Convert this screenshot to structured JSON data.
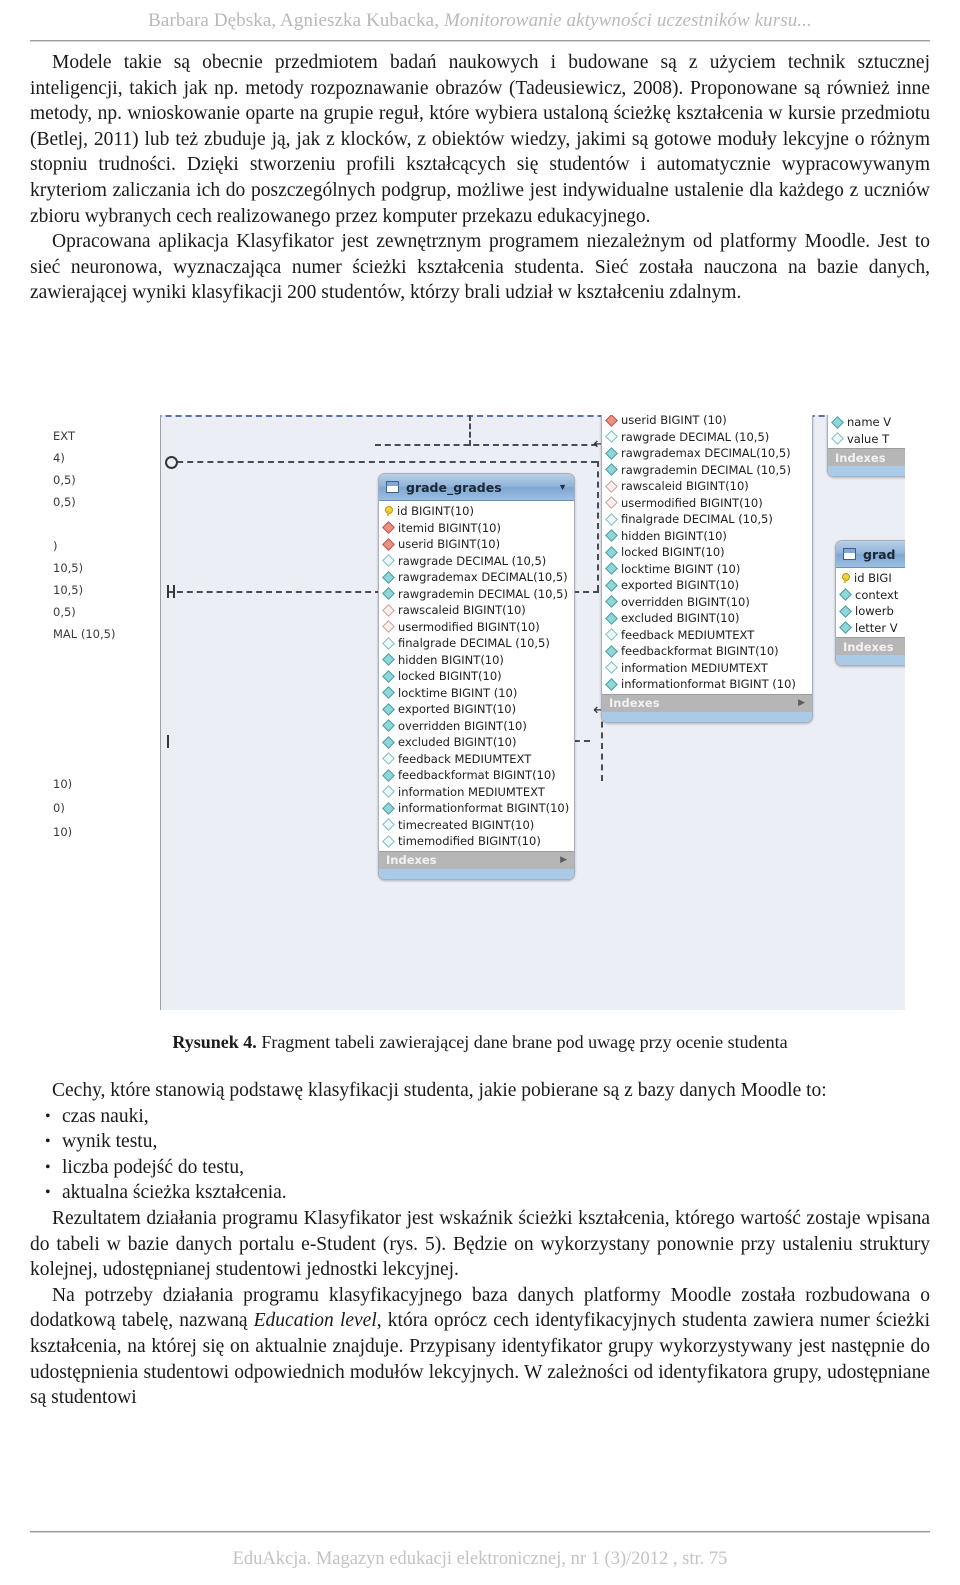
{
  "running_head": {
    "authors": "Barbara Dębska, Agnieszka Kubacka,",
    "title_italic": "Monitorowanie aktywności uczestników kursu..."
  },
  "body": {
    "paragraph_1": "Modele takie są obecnie przedmiotem badań naukowych i budowane są z użyciem technik sztucznej inteligencji, takich jak np. metody rozpoznawanie obrazów (Tadeusiewicz, 2008). Proponowane są również inne metody, np. wnioskowanie oparte na grupie reguł, które wybiera ustaloną ścieżkę kształcenia w kursie przedmiotu (Betlej, 2011) lub też zbuduje ją, jak z klocków, z obiektów wiedzy, jakimi są gotowe moduły lekcyjne o różnym stopniu trudności. Dzięki stworzeniu profili kształcących się studentów i automatycznie wypracowywanym kryteriom zaliczania ich do poszczególnych podgrup, możliwe jest indywidualne ustalenie dla każdego z uczniów zbioru wybranych cech realizowanego przez komputer przekazu edukacyjnego.",
    "paragraph_2": "Opracowana aplikacja Klasyfikator jest zewnętrznym programem niezależnym od platformy Moodle. Jest to sieć neuronowa, wyznaczająca numer ścieżki kształcenia studenta. Sieć została nauczona na bazie danych, zawierającej wyniki klasyfikacji 200 studentów, którzy brali udział w kształceniu zdalnym.",
    "paragraph_3": "Cechy, które stanowią podstawę klasyfikacji studenta, jakie pobierane są z bazy danych Moodle to:",
    "bullets": [
      "czas nauki,",
      "wynik testu,",
      "liczba podejść do testu,",
      "aktualna ścieżka kształcenia."
    ],
    "paragraph_4": "Rezultatem działania programu Klasyfikator jest wskaźnik ścieżki kształcenia, którego wartość zostaje wpisana do tabeli w bazie danych portalu e-Student (rys. 5). Będzie on wykorzystany ponownie przy ustaleniu struktury kolejnej, udostępnianej studentowi jednostki lekcyjnej.",
    "paragraph_5_a": "Na potrzeby działania programu klasyfikacyjnego baza danych platformy Moodle została rozbudowana o dodatkową tabelę, nazwaną ",
    "paragraph_5_italic": "Education level",
    "paragraph_5_b": ", która oprócz cech identyfikacyjnych studenta zawiera numer ścieżki kształcenia, na której się on aktualnie znajduje. Przypisany identyfikator grupy wykorzystywany jest następnie do udostępnienia studentowi odpowiednich modułów lekcyjnych. W zależności od identyfikatora grupy, udostępniane są studentowi"
  },
  "figure": {
    "caption_label": "Rysunek 4.",
    "caption_text": " Fragment tabeli zawierającej dane brane pod uwagę przy ocenie studenta",
    "left_fragments": [
      "EXT",
      "4)",
      "0,5)",
      "0,5)",
      ")",
      "10,5)",
      "10,5)",
      "0,5)",
      "MAL (10,5)",
      "10)",
      "0)",
      "10)"
    ],
    "entities": [
      {
        "name": "grade_grades",
        "indexes_label": "Indexes",
        "fields": [
          {
            "marker": "pk",
            "text": "id BIGINT(10)"
          },
          {
            "marker": "fk",
            "text": "itemid BIGINT(10)"
          },
          {
            "marker": "fk",
            "text": "userid BIGINT(10)"
          },
          {
            "marker": "open",
            "text": "rawgrade DECIMAL (10,5)"
          },
          {
            "marker": "filled",
            "text": "rawgrademax DECIMAL(10,5)"
          },
          {
            "marker": "filled",
            "text": "rawgrademin DECIMAL (10,5)"
          },
          {
            "marker": "open2",
            "text": "rawscaleid BIGINT(10)"
          },
          {
            "marker": "open2",
            "text": "usermodified BIGINT(10)"
          },
          {
            "marker": "open",
            "text": "finalgrade DECIMAL (10,5)"
          },
          {
            "marker": "filled",
            "text": "hidden BIGINT(10)"
          },
          {
            "marker": "filled",
            "text": "locked BIGINT(10)"
          },
          {
            "marker": "filled",
            "text": "locktime BIGINT (10)"
          },
          {
            "marker": "filled",
            "text": "exported BIGINT(10)"
          },
          {
            "marker": "filled",
            "text": "overridden BIGINT(10)"
          },
          {
            "marker": "filled",
            "text": "excluded BIGINT(10)"
          },
          {
            "marker": "open",
            "text": "feedback MEDIUMTEXT"
          },
          {
            "marker": "filled",
            "text": "feedbackformat BIGINT(10)"
          },
          {
            "marker": "open",
            "text": "information MEDIUMTEXT"
          },
          {
            "marker": "filled",
            "text": "informationformat BIGINT(10)"
          },
          {
            "marker": "open",
            "text": "timecreated BIGINT(10)"
          },
          {
            "marker": "open",
            "text": "timemodified BIGINT(10)"
          }
        ]
      },
      {
        "name": "",
        "indexes_label": "Indexes",
        "fields": [
          {
            "marker": "fk",
            "text": "userid BIGINT (10)"
          },
          {
            "marker": "open",
            "text": "rawgrade DECIMAL (10,5)"
          },
          {
            "marker": "filled",
            "text": "rawgrademax DECIMAL(10,5)"
          },
          {
            "marker": "filled",
            "text": "rawgrademin DECIMAL (10,5)"
          },
          {
            "marker": "open2",
            "text": "rawscaleid BIGINT(10)"
          },
          {
            "marker": "open2",
            "text": "usermodified BIGINT(10)"
          },
          {
            "marker": "open",
            "text": "finalgrade DECIMAL (10,5)"
          },
          {
            "marker": "filled",
            "text": "hidden BIGINT(10)"
          },
          {
            "marker": "filled",
            "text": "locked BIGINT(10)"
          },
          {
            "marker": "filled",
            "text": "locktime BIGINT (10)"
          },
          {
            "marker": "filled",
            "text": "exported BIGINT(10)"
          },
          {
            "marker": "filled",
            "text": "overridden BIGINT(10)"
          },
          {
            "marker": "filled",
            "text": "excluded BIGINT(10)"
          },
          {
            "marker": "open",
            "text": "feedback MEDIUMTEXT"
          },
          {
            "marker": "filled",
            "text": "feedbackformat BIGINT(10)"
          },
          {
            "marker": "open",
            "text": "information MEDIUMTEXT"
          },
          {
            "marker": "filled",
            "text": "informationformat BIGINT (10)"
          }
        ]
      },
      {
        "name": "",
        "indexes_label": "Indexes",
        "fields": [
          {
            "marker": "filled",
            "text": "name V"
          },
          {
            "marker": "open",
            "text": "value T"
          }
        ]
      },
      {
        "name": "grad",
        "indexes_label": "Indexes",
        "fields": [
          {
            "marker": "pk",
            "text": "id BIGI"
          },
          {
            "marker": "filled",
            "text": "context"
          },
          {
            "marker": "filled",
            "text": "lowerb"
          },
          {
            "marker": "filled",
            "text": "letter V"
          }
        ]
      }
    ]
  },
  "footer": {
    "text": "EduAkcja. Magazyn edukacji elektronicznej, nr 1 (3)/2012 , str. 75"
  },
  "colors": {
    "running_head": "#b9b9b9",
    "canvas_bg": "#eceef6",
    "entity_header": "#8fb3d9",
    "indexes_bar": "#b6b6b6",
    "pk_marker": "#f2d33c",
    "fk_marker": "#ef8e82",
    "attr_marker": "#8fd6d8"
  }
}
